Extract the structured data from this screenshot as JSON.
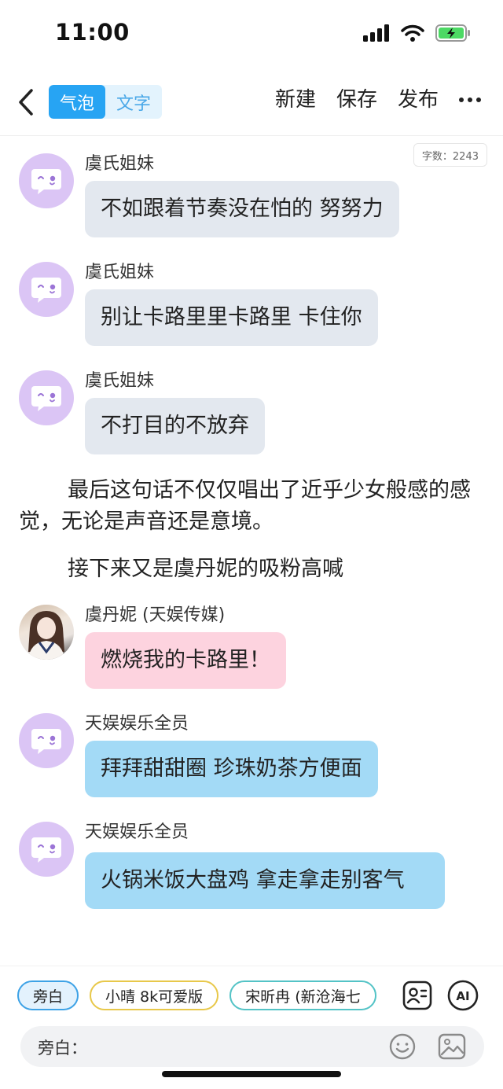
{
  "status": {
    "time": "11:00"
  },
  "nav": {
    "tabs": [
      {
        "label": "气泡",
        "active": true
      },
      {
        "label": "文字",
        "active": false
      }
    ],
    "actions": {
      "new": "新建",
      "save": "保存",
      "publish": "发布"
    }
  },
  "word_count": "字数：2243",
  "messages": [
    {
      "sender": "虞氏姐妹",
      "text": "不如跟着节奏没在怕的 努努力",
      "bubble": "gray",
      "avatar": "default-avatar-icon"
    },
    {
      "sender": "虞氏姐妹",
      "text": "别让卡路里里卡路里 卡住你",
      "bubble": "gray",
      "avatar": "default-avatar-icon"
    },
    {
      "sender": "虞氏姐妹",
      "text": "不打目的不放弃",
      "bubble": "gray",
      "avatar": "default-avatar-icon"
    },
    {
      "sender": "虞丹妮 (天娱传媒)",
      "text": "燃烧我的卡路里！",
      "bubble": "pink",
      "avatar": "user-photo"
    },
    {
      "sender": "天娱娱乐全员",
      "text": "拜拜甜甜圈 珍珠奶茶方便面",
      "bubble": "blue",
      "avatar": "default-avatar-icon"
    },
    {
      "sender": "天娱娱乐全员",
      "text": "火锅米饭大盘鸡 拿走拿走别客气",
      "bubble": "blue",
      "avatar": "default-avatar-icon"
    }
  ],
  "narration": [
    "最后这句话不仅仅唱出了近乎少女般感的感觉，无论是声音还是意境。",
    "接下来又是虞丹妮的吸粉高喊"
  ],
  "roles": [
    {
      "label": "旁白",
      "color": "#3da2e6"
    },
    {
      "label": "小晴 8k可爱版",
      "color": "#e8c84a"
    },
    {
      "label": "宋昕冉 (新沧海七",
      "color": "#53c3c6"
    }
  ],
  "input": {
    "label": "旁白："
  },
  "colors": {
    "accent": "#27a4f3",
    "bubble_gray": "#e3e8ef",
    "bubble_pink": "#fdd3df",
    "bubble_blue": "#a3daf6",
    "avatar_purple": "#dbc5f5"
  }
}
